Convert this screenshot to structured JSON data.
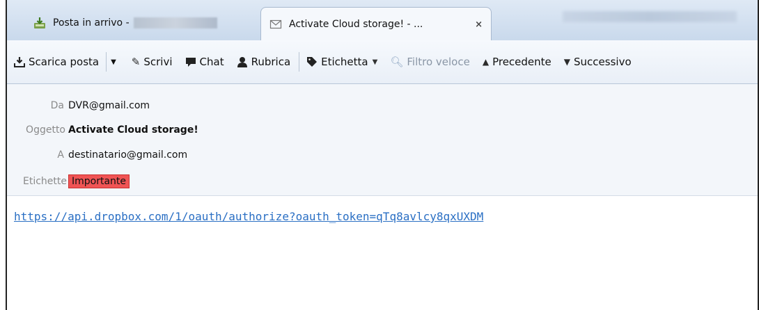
{
  "tabs": [
    {
      "label": "Posta in arrivo -",
      "icon": "inbox-download-icon"
    },
    {
      "label": "Activate Cloud storage! - ...",
      "icon": "envelope-icon",
      "close": "×"
    }
  ],
  "toolbar": {
    "get_mail": "Scarica posta",
    "write": "Scrivi",
    "chat": "Chat",
    "address_book": "Rubrica",
    "tag": "Etichetta",
    "quick_filter": "Filtro veloce",
    "previous": "Precedente",
    "next": "Successivo"
  },
  "headers": {
    "from_label": "Da",
    "from_value": "DVR@gmail.com",
    "subject_label": "Oggetto",
    "subject_value": "Activate Cloud storage!",
    "to_label": "A",
    "to_value": "destinatario@gmail.com",
    "tags_label": "Etichette",
    "tag_value": "Importante",
    "tag_color": "#f05454"
  },
  "body": {
    "link": "https://api.dropbox.com/1/oauth/authorize?oauth_token=qTq8avlcy8qxUXDM"
  },
  "colors": {
    "link": "#2a6fc4",
    "tabstrip": "#c9d9ec"
  }
}
